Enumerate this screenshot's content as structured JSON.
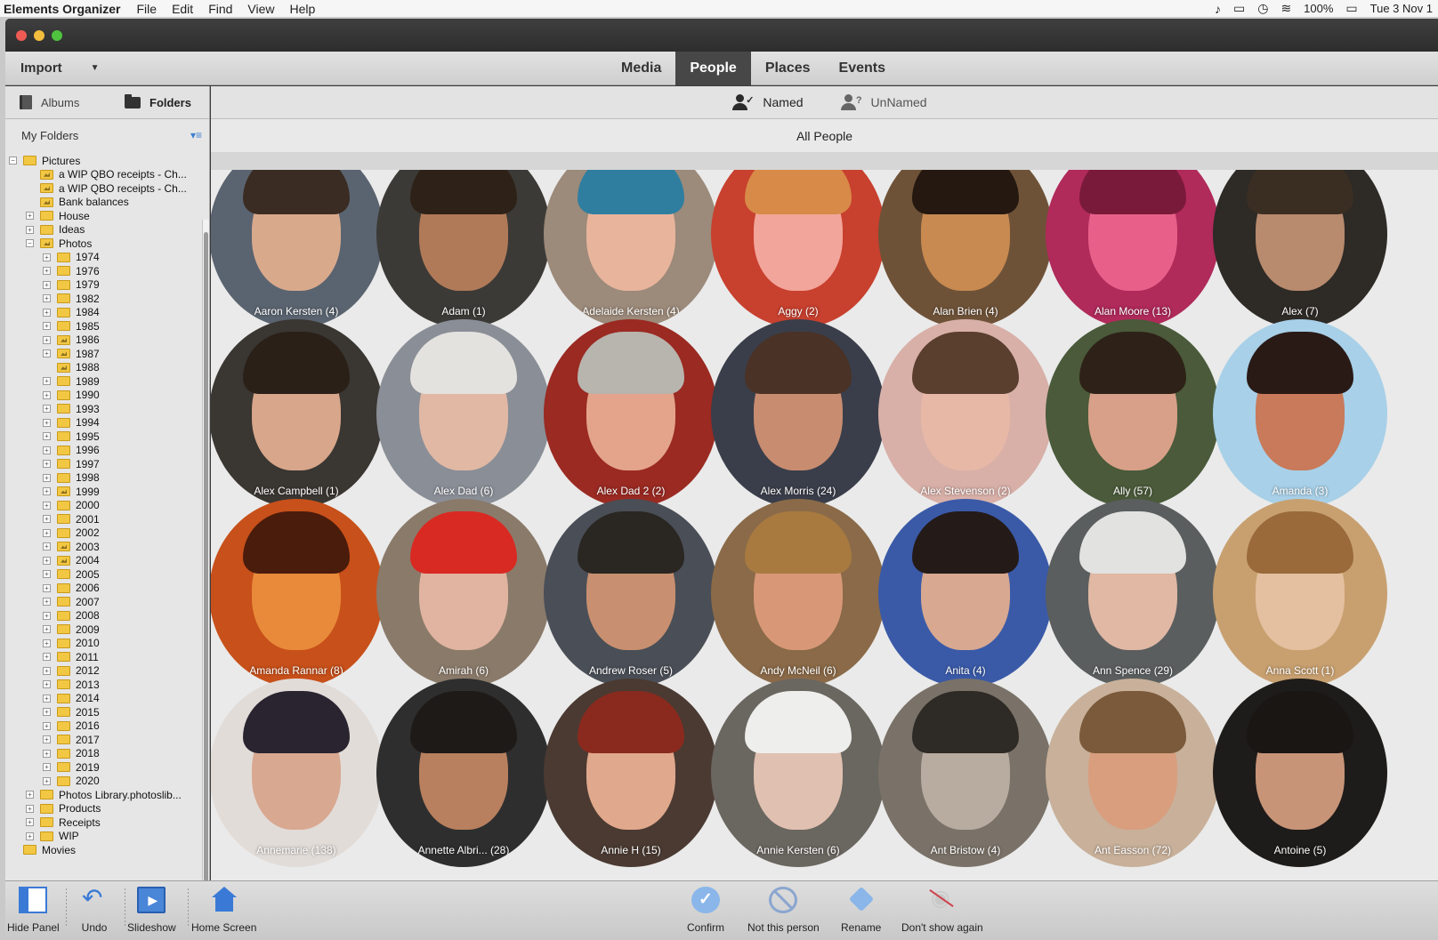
{
  "menubar": {
    "app": "Elements Organizer",
    "items": [
      "File",
      "Edit",
      "Find",
      "View",
      "Help"
    ],
    "battery": "100%",
    "clock": "Tue 3 Nov 1"
  },
  "toolbar": {
    "import_label": "Import",
    "tabs": [
      "Media",
      "People",
      "Places",
      "Events"
    ],
    "active_tab": "People"
  },
  "left_panel": {
    "tabs": {
      "albums": "Albums",
      "folders": "Folders"
    },
    "section_title": "My Folders",
    "tree": [
      {
        "label": "Pictures",
        "level": 0,
        "toggle": "minus",
        "icon": "folder"
      },
      {
        "label": "a WIP QBO receipts - Ch...",
        "level": 1,
        "toggle": "",
        "icon": "image-folder"
      },
      {
        "label": "a WIP QBO receipts - Ch...",
        "level": 1,
        "toggle": "",
        "icon": "image-folder"
      },
      {
        "label": "Bank balances",
        "level": 1,
        "toggle": "",
        "icon": "image-folder"
      },
      {
        "label": "House",
        "level": 1,
        "toggle": "plus",
        "icon": "folder"
      },
      {
        "label": "Ideas",
        "level": 1,
        "toggle": "plus",
        "icon": "folder"
      },
      {
        "label": "Photos",
        "level": 1,
        "toggle": "minus",
        "icon": "image-folder"
      },
      {
        "label": "1974",
        "level": 2,
        "toggle": "plus",
        "icon": "folder"
      },
      {
        "label": "1976",
        "level": 2,
        "toggle": "plus",
        "icon": "folder"
      },
      {
        "label": "1979",
        "level": 2,
        "toggle": "plus",
        "icon": "folder"
      },
      {
        "label": "1982",
        "level": 2,
        "toggle": "plus",
        "icon": "folder"
      },
      {
        "label": "1984",
        "level": 2,
        "toggle": "plus",
        "icon": "folder"
      },
      {
        "label": "1985",
        "level": 2,
        "toggle": "plus",
        "icon": "folder"
      },
      {
        "label": "1986",
        "level": 2,
        "toggle": "plus",
        "icon": "image-folder"
      },
      {
        "label": "1987",
        "level": 2,
        "toggle": "plus",
        "icon": "image-folder"
      },
      {
        "label": "1988",
        "level": 2,
        "toggle": "",
        "icon": "image-folder"
      },
      {
        "label": "1989",
        "level": 2,
        "toggle": "plus",
        "icon": "folder"
      },
      {
        "label": "1990",
        "level": 2,
        "toggle": "plus",
        "icon": "folder"
      },
      {
        "label": "1993",
        "level": 2,
        "toggle": "plus",
        "icon": "folder"
      },
      {
        "label": "1994",
        "level": 2,
        "toggle": "plus",
        "icon": "folder"
      },
      {
        "label": "1995",
        "level": 2,
        "toggle": "plus",
        "icon": "folder"
      },
      {
        "label": "1996",
        "level": 2,
        "toggle": "plus",
        "icon": "folder"
      },
      {
        "label": "1997",
        "level": 2,
        "toggle": "plus",
        "icon": "folder"
      },
      {
        "label": "1998",
        "level": 2,
        "toggle": "plus",
        "icon": "folder"
      },
      {
        "label": "1999",
        "level": 2,
        "toggle": "plus",
        "icon": "image-folder"
      },
      {
        "label": "2000",
        "level": 2,
        "toggle": "plus",
        "icon": "folder"
      },
      {
        "label": "2001",
        "level": 2,
        "toggle": "plus",
        "icon": "folder"
      },
      {
        "label": "2002",
        "level": 2,
        "toggle": "plus",
        "icon": "folder"
      },
      {
        "label": "2003",
        "level": 2,
        "toggle": "plus",
        "icon": "image-folder"
      },
      {
        "label": "2004",
        "level": 2,
        "toggle": "plus",
        "icon": "image-folder"
      },
      {
        "label": "2005",
        "level": 2,
        "toggle": "plus",
        "icon": "folder"
      },
      {
        "label": "2006",
        "level": 2,
        "toggle": "plus",
        "icon": "folder"
      },
      {
        "label": "2007",
        "level": 2,
        "toggle": "plus",
        "icon": "folder"
      },
      {
        "label": "2008",
        "level": 2,
        "toggle": "plus",
        "icon": "folder"
      },
      {
        "label": "2009",
        "level": 2,
        "toggle": "plus",
        "icon": "folder"
      },
      {
        "label": "2010",
        "level": 2,
        "toggle": "plus",
        "icon": "folder"
      },
      {
        "label": "2011",
        "level": 2,
        "toggle": "plus",
        "icon": "folder"
      },
      {
        "label": "2012",
        "level": 2,
        "toggle": "plus",
        "icon": "folder"
      },
      {
        "label": "2013",
        "level": 2,
        "toggle": "plus",
        "icon": "folder"
      },
      {
        "label": "2014",
        "level": 2,
        "toggle": "plus",
        "icon": "folder"
      },
      {
        "label": "2015",
        "level": 2,
        "toggle": "plus",
        "icon": "folder"
      },
      {
        "label": "2016",
        "level": 2,
        "toggle": "plus",
        "icon": "folder"
      },
      {
        "label": "2017",
        "level": 2,
        "toggle": "plus",
        "icon": "folder"
      },
      {
        "label": "2018",
        "level": 2,
        "toggle": "plus",
        "icon": "folder"
      },
      {
        "label": "2019",
        "level": 2,
        "toggle": "plus",
        "icon": "folder"
      },
      {
        "label": "2020",
        "level": 2,
        "toggle": "plus",
        "icon": "folder"
      },
      {
        "label": "Photos Library.photoslib...",
        "level": 1,
        "toggle": "plus",
        "icon": "folder"
      },
      {
        "label": "Products",
        "level": 1,
        "toggle": "plus",
        "icon": "folder"
      },
      {
        "label": "Receipts",
        "level": 1,
        "toggle": "plus",
        "icon": "folder"
      },
      {
        "label": "WIP",
        "level": 1,
        "toggle": "plus",
        "icon": "folder"
      },
      {
        "label": "Movies",
        "level": 0,
        "toggle": "",
        "icon": "folder"
      }
    ]
  },
  "people_view": {
    "subtabs": {
      "named": "Named",
      "unnamed": "UnNamed"
    },
    "active_subtab": "Named",
    "heading": "All People",
    "people": [
      {
        "label": "Aaron Kersten (4)",
        "bg": "#5a6470",
        "skin": "#d9a98c",
        "hair": "#3a2c22"
      },
      {
        "label": "Adam (1)",
        "bg": "#3c3a36",
        "skin": "#b07a58",
        "hair": "#2e2218"
      },
      {
        "label": "Adelaide Kersten (4)",
        "bg": "#9c8a7a",
        "skin": "#e8b49c",
        "hair": "#2f7ea0"
      },
      {
        "label": "Aggy (2)",
        "bg": "#c8402e",
        "skin": "#f2a59a",
        "hair": "#d88a48"
      },
      {
        "label": "Alan Brien (4)",
        "bg": "#6e5238",
        "skin": "#c88a50",
        "hair": "#241810"
      },
      {
        "label": "Alan Moore (13)",
        "bg": "#b02a5a",
        "skin": "#e8608a",
        "hair": "#7a1a3a"
      },
      {
        "label": "Alex (7)",
        "bg": "#2e2a26",
        "skin": "#b88a6e",
        "hair": "#3a2e22"
      },
      {
        "label": "Alex Campbell (1)",
        "bg": "#3a3632",
        "skin": "#d8a68a",
        "hair": "#2a2018"
      },
      {
        "label": "Alex Dad (6)",
        "bg": "#8a8e96",
        "skin": "#e0b8a4",
        "hair": "#e4e2de"
      },
      {
        "label": "Alex Dad 2 (2)",
        "bg": "#9a2a22",
        "skin": "#e4a48c",
        "hair": "#b8b4ae"
      },
      {
        "label": "Alex Morris (24)",
        "bg": "#3a3e4a",
        "skin": "#c88c70",
        "hair": "#4a3226"
      },
      {
        "label": "Alex Stevenson (2)",
        "bg": "#d8b0a8",
        "skin": "#e8b8a6",
        "hair": "#5a3e2e"
      },
      {
        "label": "Ally (57)",
        "bg": "#4a5a3a",
        "skin": "#d8a088",
        "hair": "#2e2218"
      },
      {
        "label": "Amanda (3)",
        "bg": "#a8d0e8",
        "skin": "#c87a5a",
        "hair": "#2a1a16"
      },
      {
        "label": "Amanda Rannar (8)",
        "bg": "#c8501a",
        "skin": "#e88a3a",
        "hair": "#4a1c0c"
      },
      {
        "label": "Amirah (6)",
        "bg": "#8a7a6a",
        "skin": "#e0b4a0",
        "hair": "#d82a22"
      },
      {
        "label": "Andrew Roser (5)",
        "bg": "#4a4e56",
        "skin": "#c89070",
        "hair": "#2a2622"
      },
      {
        "label": "Andy McNeil (6)",
        "bg": "#8a6a48",
        "skin": "#d89878",
        "hair": "#a87a40"
      },
      {
        "label": "Anita (4)",
        "bg": "#3a5aa8",
        "skin": "#d8a890",
        "hair": "#241a18"
      },
      {
        "label": "Ann Spence (29)",
        "bg": "#5a5e5e",
        "skin": "#e0b8a4",
        "hair": "#e2e2e0"
      },
      {
        "label": "Anna Scott (1)",
        "bg": "#c8a070",
        "skin": "#e4c0a0",
        "hair": "#9a6a3a"
      },
      {
        "label": "Annemarie (138)",
        "bg": "#e2dcd8",
        "skin": "#d8a890",
        "hair": "#2a2430",
        "warn": true
      },
      {
        "label": "Annette Albri... (28)",
        "bg": "#2e2e2e",
        "skin": "#b8805e",
        "hair": "#1e1a18"
      },
      {
        "label": "Annie H (15)",
        "bg": "#4a3a32",
        "skin": "#e0a88c",
        "hair": "#8a2a1e"
      },
      {
        "label": "Annie Kersten (6)",
        "bg": "#6a6660",
        "skin": "#e0c0b0",
        "hair": "#eeeeec"
      },
      {
        "label": "Ant Bristow (4)",
        "bg": "#7a7268",
        "skin": "#b8aca0",
        "hair": "#2e2a26"
      },
      {
        "label": "Ant Easson (72)",
        "bg": "#c8b09a",
        "skin": "#d89e7e",
        "hair": "#7a5a3a"
      },
      {
        "label": "Antoine (5)",
        "bg": "#1e1c1a",
        "skin": "#c89478",
        "hair": "#1a1614"
      }
    ]
  },
  "bottombar": {
    "left": [
      {
        "label": "Hide Panel",
        "icon": "hide-panel-icon"
      },
      {
        "label": "Undo",
        "icon": "undo-icon"
      },
      {
        "label": "Slideshow",
        "icon": "slideshow-icon"
      },
      {
        "label": "Home Screen",
        "icon": "home-icon"
      }
    ],
    "right": [
      {
        "label": "Confirm",
        "icon": "confirm-icon"
      },
      {
        "label": "Not this person",
        "icon": "not-icon"
      },
      {
        "label": "Rename",
        "icon": "rename-icon"
      },
      {
        "label": "Don't show again",
        "icon": "hide-eye-icon"
      }
    ]
  }
}
